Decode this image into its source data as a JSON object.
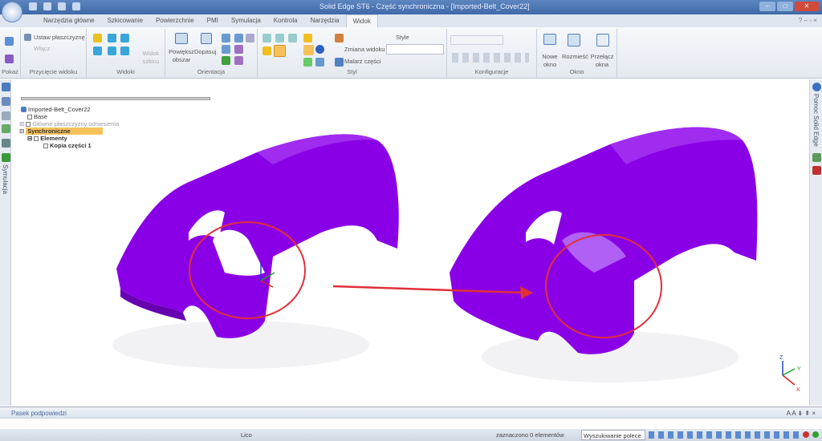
{
  "window": {
    "title": "Solid Edge ST6 - Część synchroniczna - [Imported-Belt_Cover22]",
    "controls": [
      "minimize",
      "restore",
      "close"
    ]
  },
  "tabs": [
    {
      "label": "Narzędzia główne"
    },
    {
      "label": "Szkicowanie"
    },
    {
      "label": "Powierzchnie"
    },
    {
      "label": "PMI"
    },
    {
      "label": "Symulacja"
    },
    {
      "label": "Kontrola"
    },
    {
      "label": "Narzędzia"
    },
    {
      "label": "Widok",
      "active": true
    }
  ],
  "ribbon": {
    "groups": {
      "pokaz": "Pokaż",
      "przyciecie": "Przycięcie widoku",
      "widoki": "Widoki",
      "orientacja": "Orientacja",
      "styl": "Styl",
      "konfiguracje": "Konfiguracje",
      "okno": "Okno"
    },
    "ustaw": "Ustaw płaszczyznę",
    "wlacz": "Włącz",
    "widok_szkicu": "Widok szkicu",
    "powieksz": "Powiększ obszar",
    "dopasuj": "Dopasuj",
    "zmiana_widoku": "Zmiana widoku",
    "malarz": "Malarz części",
    "style": "Style",
    "nowe_okno": "Nowe okno",
    "rozmiesc": "Rozmieść",
    "przelacz": "Przełącz okna"
  },
  "tree": {
    "root": "Imported-Belt_Cover22",
    "base": "Base",
    "planes": "Główne płaszczyzny odniesienia",
    "sync": "Synchroniczne",
    "elements": "Elementy",
    "copy": "Kopia części 1"
  },
  "left_panel": {
    "label": "Symulacja"
  },
  "right_panel": {
    "label": "Pomoc Solid Edge"
  },
  "hint_bar": {
    "label": "Pasek podpowiedzi",
    "controls": "A A ⇟ ⇞ ×"
  },
  "status": {
    "mode": "Lico",
    "selection": "zaznaczono 0 elementów",
    "search_placeholder": "Wyszukiwanie polece"
  },
  "colors": {
    "part": "#8a00e6",
    "annotation": "#e0303a",
    "accent": "#f5c25a"
  },
  "triad": {
    "x": "X",
    "y": "Y",
    "z": "Z"
  }
}
